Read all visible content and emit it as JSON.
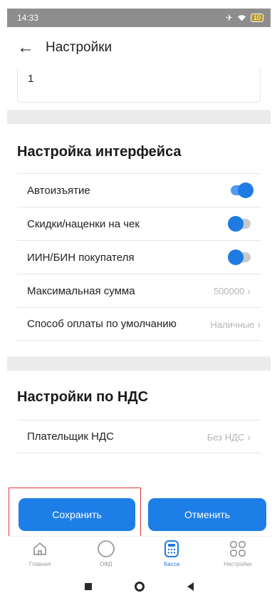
{
  "status_bar": {
    "time": "14:33",
    "battery": "10"
  },
  "header": {
    "title": "Настройки"
  },
  "previous_field": {
    "value": "1"
  },
  "interface_settings": {
    "title": "Настройка интерфейса",
    "rows": [
      {
        "label": "Автоизъятие",
        "toggle_on": true
      },
      {
        "label": "Скидки/наценки на чек",
        "toggle_on": false
      },
      {
        "label": "ИИН/БИН покупателя",
        "toggle_on": false
      },
      {
        "label": "Максимальная сумма",
        "value": "500000"
      },
      {
        "label": "Способ оплаты по умолчанию",
        "value": "Наличные"
      }
    ]
  },
  "vat_settings": {
    "title": "Настройки по НДС",
    "rows": [
      {
        "label": "Плательщик НДС",
        "value": "Без НДС"
      }
    ]
  },
  "buttons": {
    "save": "Сохранить",
    "cancel": "Отменить"
  },
  "tab_bar": {
    "items": [
      {
        "label": "Главная",
        "icon": "home-icon",
        "active": false
      },
      {
        "label": "ОФД",
        "icon": "circle-icon",
        "active": false
      },
      {
        "label": "Касса",
        "icon": "calculator-icon",
        "active": true
      },
      {
        "label": "Настройки",
        "icon": "grid-icon",
        "active": false
      }
    ]
  },
  "colors": {
    "accent": "#1e7be3",
    "highlight": "#e03a3a",
    "status_bar": "#8d8d8d"
  }
}
